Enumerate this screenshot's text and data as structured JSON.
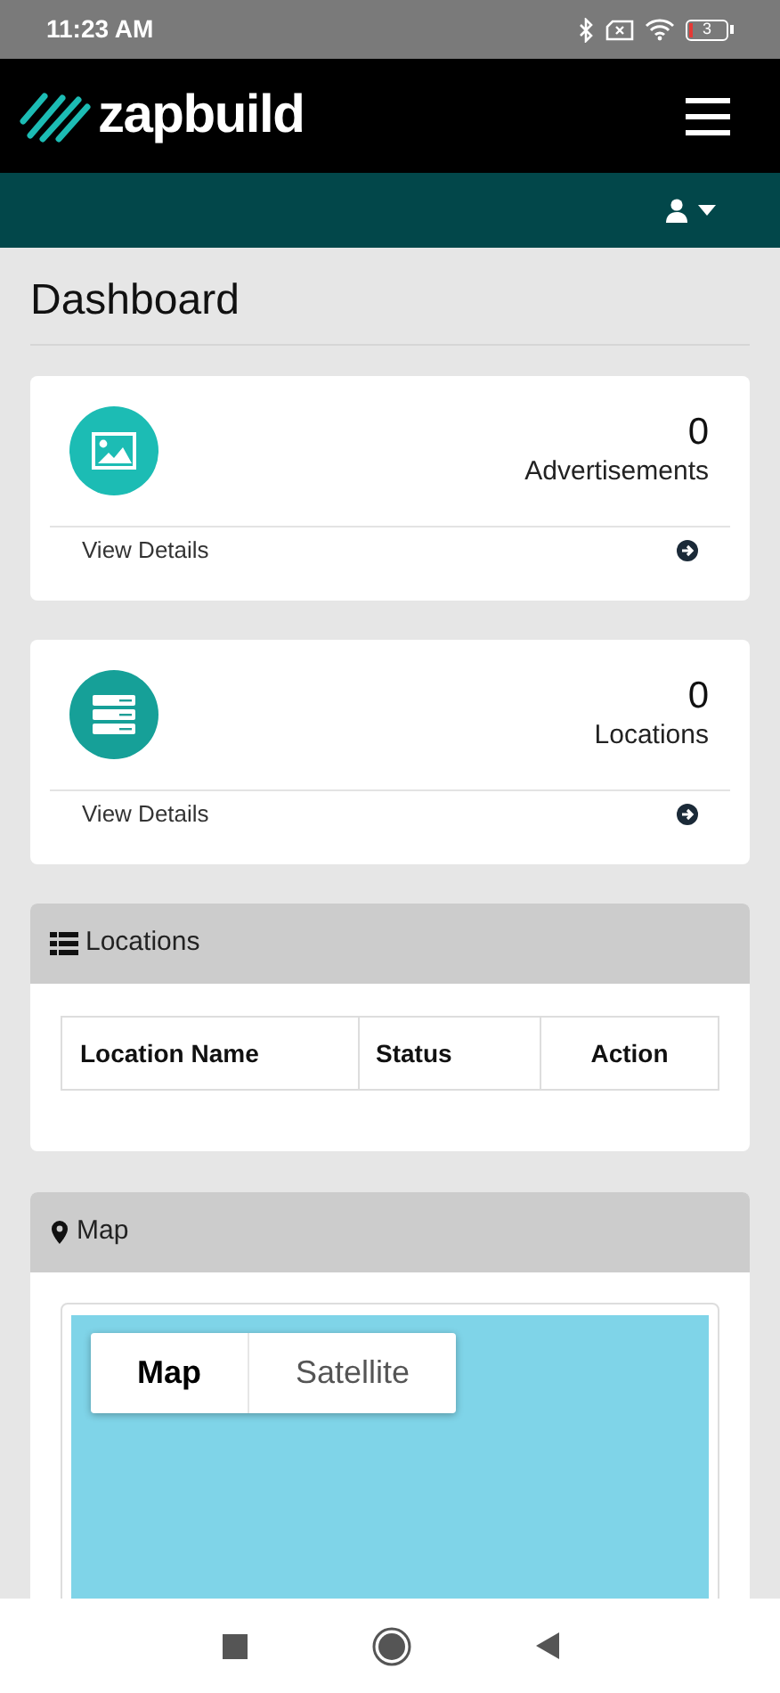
{
  "status_bar": {
    "time": "11:23 AM",
    "battery": "3"
  },
  "header": {
    "logo": "zapbuild"
  },
  "page_title": "Dashboard",
  "stat_cards": [
    {
      "kind": "image",
      "count": "0",
      "label": "Advertisements",
      "link": "View Details"
    },
    {
      "kind": "list",
      "count": "0",
      "label": "Locations",
      "link": "View Details"
    }
  ],
  "locations_panel": {
    "title": "Locations",
    "table": {
      "columns": [
        "Location Name",
        "Status",
        "Action"
      ]
    }
  },
  "map_panel": {
    "title": "Map",
    "map_types": [
      {
        "label": "Map",
        "selected": true
      },
      {
        "label": "Satellite",
        "selected": false
      }
    ]
  }
}
